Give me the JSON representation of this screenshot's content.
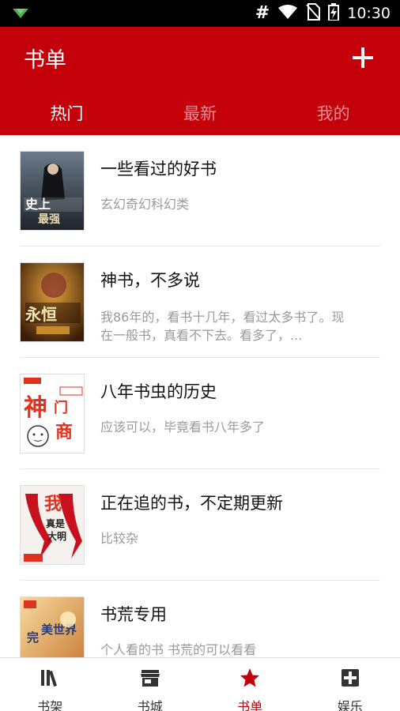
{
  "status_bar": {
    "time": "10:30",
    "hash_glyph": "#",
    "icons": [
      "notification-icon",
      "wifi-icon",
      "no-sim-icon",
      "battery-charging-icon"
    ]
  },
  "header": {
    "title": "书单",
    "add_icon": "plus-icon"
  },
  "tabs": [
    {
      "label": "热门",
      "active": true
    },
    {
      "label": "最新",
      "active": false
    },
    {
      "label": "我的",
      "active": false
    }
  ],
  "booklists": [
    {
      "title": "一些看过的好书",
      "desc": "玄幻奇幻科幻类"
    },
    {
      "title": "神书，不多说",
      "desc": "我86年的，看书十几年，看过太多书了。现在一般书，真看不下去。看多了，..."
    },
    {
      "title": "八年书虫的历史",
      "desc": "应该可以，毕竟看书八年多了"
    },
    {
      "title": "正在追的书，不定期更新",
      "desc": "比较杂"
    },
    {
      "title": "书荒专用",
      "desc": "个人看的书 书荒的可以看看"
    }
  ],
  "bottom_nav": [
    {
      "label": "书架",
      "icon": "bookshelf-icon",
      "active": false
    },
    {
      "label": "书城",
      "icon": "store-icon",
      "active": false
    },
    {
      "label": "书单",
      "icon": "star-icon",
      "active": true
    },
    {
      "label": "娱乐",
      "icon": "puzzle-icon",
      "active": false
    }
  ],
  "colors": {
    "primary": "#c4000a",
    "tab_inactive": "#f0a0a4",
    "desc_text": "#9a9a9a"
  }
}
